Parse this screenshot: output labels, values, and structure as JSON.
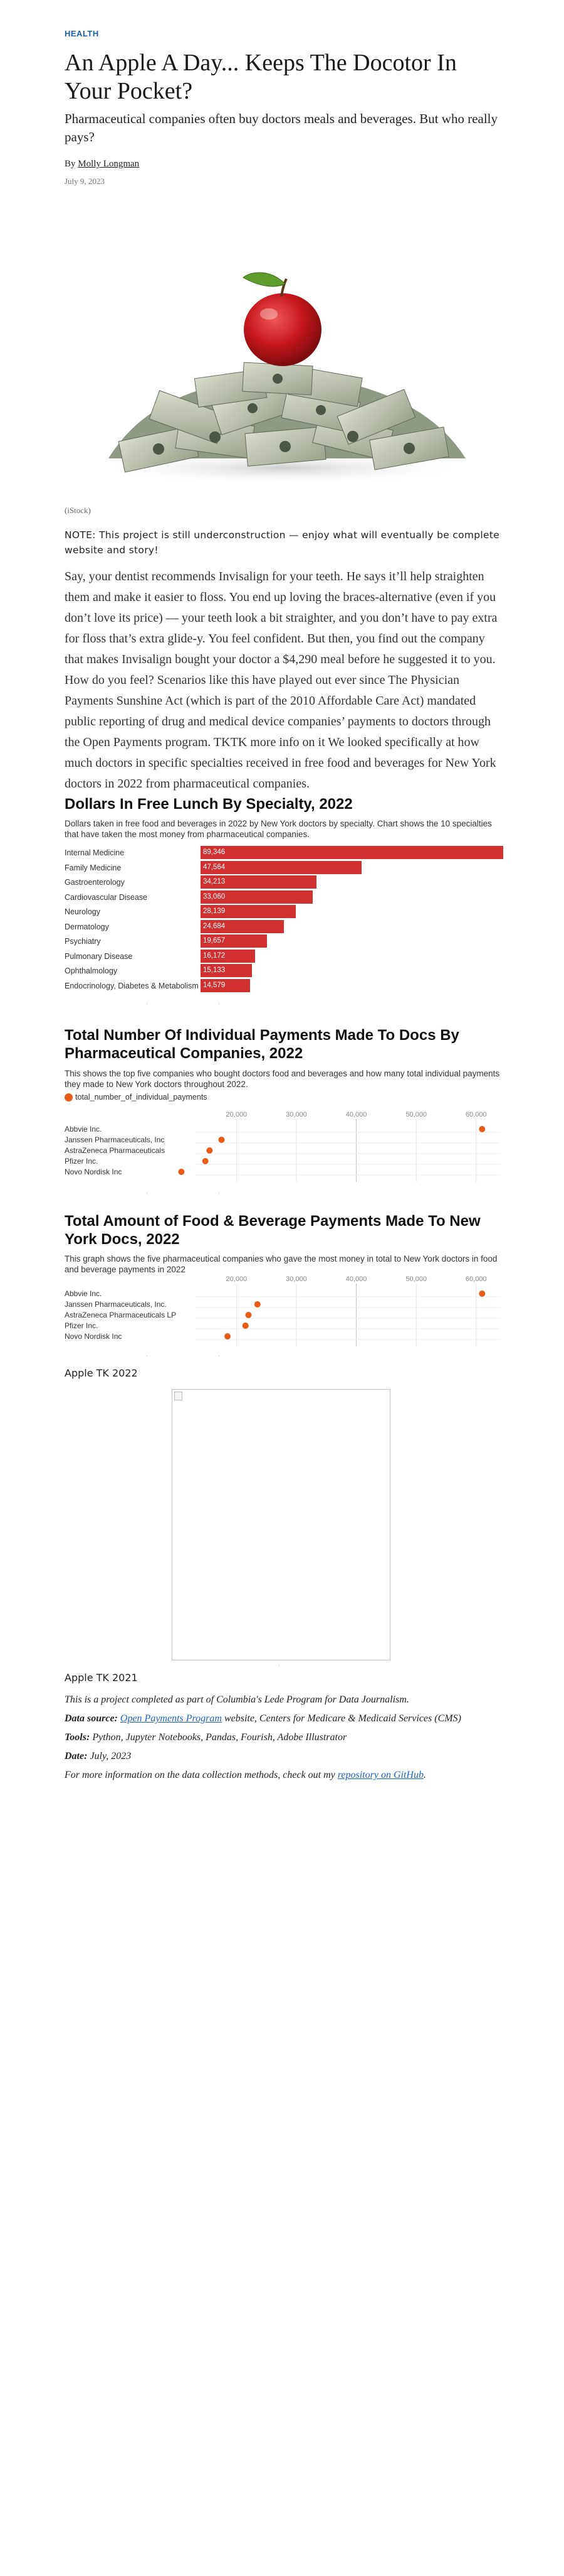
{
  "article": {
    "kicker": "HEALTH",
    "headline": "An Apple A Day... Keeps The Docotor In Your Pocket?",
    "dek": "Pharmaceutical companies often buy doctors meals and beverages. But who really pays?",
    "byline_prefix": "By ",
    "author": "Molly Longman",
    "date": "July 9, 2023",
    "image_caption": "(iStock)",
    "note": "NOTE: This project is still underconstruction — enjoy what will eventually be complete website and story!",
    "body": "Say, your dentist recommends Invisalign for your teeth. He says it’ll help straighten them and make it easier to floss. You end up loving the braces-alternative (even if you don’t love its price) — your teeth look a bit straighter, and you don’t have to pay extra for floss that’s extra glide-y. You feel confident. But then, you find out the company that makes Invisalign bought your doctor a $4,290 meal before he suggested it to you. How do you feel? Scenarios like this have played out ever since The Physician Payments Sunshine Act (which is part of the 2010 Affordable Care Act) mandated public reporting of drug and medical device companies’ payments to doctors through the Open Payments program. TKTK more info on it We looked specifically at how much doctors in specific specialties received in free food and beverages for New York doctors in 2022 from pharmaceutical companies."
  },
  "colors": {
    "bar": "#d2302f",
    "dot": "#e85c17",
    "link": "#1a66c5",
    "kicker": "#1d5fa8"
  },
  "chart_data": [
    {
      "type": "bar",
      "title": "Dollars In Free Lunch By Specialty, 2022",
      "subtitle": "Dollars taken in free food and beverages in 2022 by New York doctors by specialty. Chart shows the 10 specialties that have taken the most money from pharmaceutical companies.",
      "categories": [
        "Internal Medicine",
        "Family Medicine",
        "Gastroenterology",
        "Cardiovascular Disease",
        "Neurology",
        "Dermatology",
        "Psychiatry",
        "Pulmonary Disease",
        "Ophthalmology",
        "Endocrinology, Diabetes & Metabolism"
      ],
      "values": [
        89346,
        47564,
        34213,
        33060,
        28139,
        24684,
        19657,
        16172,
        15133,
        14579
      ],
      "value_labels": [
        "89,346",
        "47,564",
        "34,213",
        "33,060",
        "28,139",
        "24,684",
        "19,657",
        "16,172",
        "15,133",
        "14,579"
      ],
      "xlim": [
        0,
        89346
      ]
    },
    {
      "type": "scatter",
      "title": "Total Number Of Individual Payments Made To Docs By Pharmaceutical Companies, 2022",
      "subtitle": "This shows the top five companies who bought doctors food and beverages and how many total individual payments they made to New York doctors throughout 2022.",
      "legend": "total_number_of_individual_payments",
      "categories": [
        "Abbvie Inc.",
        "Janssen Pharmaceuticals, Inc",
        "AstraZeneca Pharmaceuticals",
        "Pfizer Inc.",
        "Novo Nordisk Inc"
      ],
      "values": [
        61000,
        17500,
        15500,
        14800,
        10800
      ],
      "x_ticks": [
        "20,000",
        "30,000",
        "40,000",
        "50,000",
        "60,000"
      ],
      "xlim": [
        14000,
        64000
      ]
    },
    {
      "type": "scatter",
      "title": "Total Amount of Food & Beverage Payments Made To New York Docs, 2022",
      "subtitle": "This graph shows the five pharmaceutical companies who gave the most money in total to New York doctors in food and beverage payments in 2022",
      "categories": [
        "Abbvie Inc.",
        "Janssen Pharmaceuticals, Inc.",
        "AstraZeneca Pharmaceuticals LP",
        "Pfizer Inc.",
        "Novo Nordisk Inc"
      ],
      "values": [
        61000,
        23500,
        22000,
        21500,
        18500
      ],
      "x_ticks": [
        "20,000",
        "30,000",
        "40,000",
        "50,000",
        "60,000"
      ],
      "xlim": [
        14000,
        64000
      ]
    }
  ],
  "sections": {
    "tk_2022": "Apple TK 2022",
    "tk_2021": "Apple TK 2021"
  },
  "footer": {
    "line1": "This is a project completed as part of Columbia's Lede Program for Data Journalism.",
    "data_source_label": "Data source:",
    "data_source_link": "Open Payments Program",
    "data_source_rest": " website, Centers for Medicare & Medicaid Services (CMS)",
    "tools_label": "Tools:",
    "tools_rest": " Python, Jupyter Notebooks, Pandas, Fourish, Adobe Illustrator",
    "date_label": "Date:",
    "date_rest": " July, 2023",
    "more_prefix": "For more information on the data collection methods, check out my ",
    "more_link": "repository on GitHub",
    "more_suffix": "."
  },
  "hero_icon": "apple-on-money-pile"
}
